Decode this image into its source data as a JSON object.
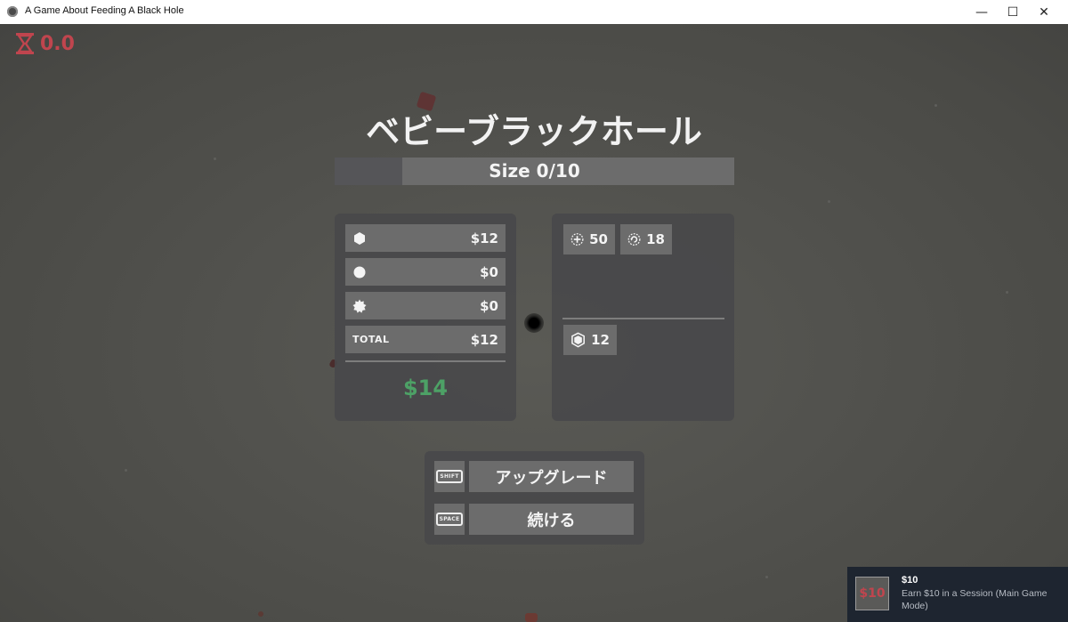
{
  "window": {
    "title": "A Game About Feeding A Black Hole",
    "minimize_glyph": "—",
    "maximize_glyph": "☐",
    "close_glyph": "✕"
  },
  "hud": {
    "timer": "0.0",
    "timer_icon": "hourglass-icon"
  },
  "heading": "ベビーブラックホール",
  "size_bar": {
    "label": "Size 0/10",
    "progress": 0.17
  },
  "earnings": {
    "rows": [
      {
        "icon": "hexagon-icon",
        "value": "$12"
      },
      {
        "icon": "circle-icon",
        "value": "$0"
      },
      {
        "icon": "starburst-icon",
        "value": "$0"
      }
    ],
    "total_label": "TOTAL",
    "total_value": "$12",
    "balance": "$14"
  },
  "stats": {
    "chips_top": [
      {
        "icon": "crosshair-plus-icon",
        "value": "50"
      },
      {
        "icon": "refresh-ring-icon",
        "value": "18"
      }
    ],
    "chips_bottom": [
      {
        "icon": "shield-icon",
        "value": "12"
      }
    ]
  },
  "actions": {
    "upgrade": {
      "key": "SHIFT",
      "label": "アップグレード"
    },
    "continue": {
      "key": "SPACE",
      "label": "続ける"
    }
  },
  "achievement": {
    "badge": "$10",
    "title": "$10",
    "description": "Earn $10 in a Session (Main Game Mode)"
  },
  "colors": {
    "accent_red": "#c0454e",
    "money_green": "#4da166"
  }
}
